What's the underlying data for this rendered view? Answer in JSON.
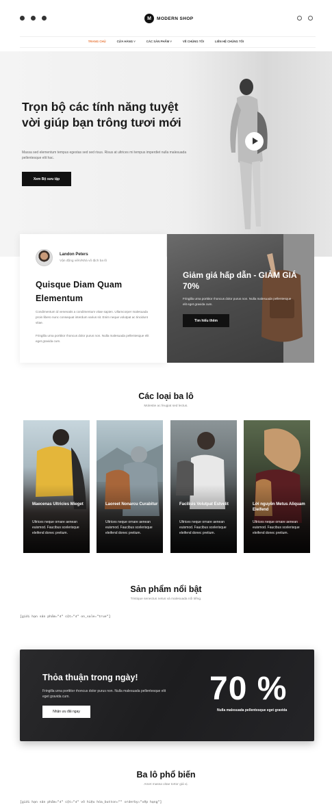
{
  "header": {
    "logo_letter": "M",
    "logo_text": "MODERN SHOP",
    "social_icons": [
      "facebook-icon",
      "twitter-icon",
      "instagram-icon"
    ],
    "utility_icons": [
      "search-icon",
      "user-icon"
    ]
  },
  "nav": {
    "items": [
      "TRANG CHỦ",
      "CỬA HÀNG ˅",
      "CÁC SẢN PHẨM ˅",
      "VỀ CHÚNG TÔI",
      "LIÊN HỆ CHÚNG TÔI"
    ],
    "active_color": "#e8773a"
  },
  "hero": {
    "title": "Trọn bộ các tính năng tuyệt vời giúp bạn trông tươi mới",
    "text": "Massa sed elementum tempus egestas sed sed risus. Risus at ultrices mi tempus imperdiet nulla malesuada pellentesque elit hac.",
    "button": "Xem Bộ sưu tập"
  },
  "testimonial": {
    "name": "Landon Peters",
    "role": "Vận động viên/Nhà vô địch ba lô",
    "title": "Quisque Diam Quam Elementum",
    "p1": "Condimentum id venenatis a condimentum vitae sapien. Ullamcorper malesuada proin libero nunc consequat interdum varius sit. Enim neque volutpat ac tincidunt vitae.",
    "p2": "Fringilla urna porttitor rhoncus dolor purus non. Nulla malesuada pellentesque elit eget gravida cum."
  },
  "promo": {
    "title": "Giảm giá hấp dẫn - GIẢM GIÁ 70%",
    "text": "Fringilla urna porttitor rhoncus dolor purus non. Nulla malesuada pellentesque elit eget gravida cum.",
    "button": "Tìm hiểu thêm"
  },
  "categories": {
    "title": "Các loại ba lô",
    "subtitle": "Molestie ac feugiat sed lectus.",
    "items": [
      {
        "title": "Maecenas Ultricies Mieget",
        "text": "Ultrices neque ornare aenean euismod. Faucibus scelerisque eleifend donec pretium."
      },
      {
        "title": "Laoreet Nonarcu Curabitur",
        "text": "Ultrices neque ornare aenean euismod. Faucibus scelerisque eleifend donec pretium."
      },
      {
        "title": "Facilisis Volutpat Estvelit",
        "text": "Ultrices neque ornare aenean euismod. Faucibus scelerisque eleifend donec pretium."
      },
      {
        "title": "Lời nguyền Metus Aliquam Eleifend",
        "text": "Ultrices neque ornare aenean euismod. Faucibus scelerisque eleifend donec pretium."
      }
    ]
  },
  "featured": {
    "title": "Sản phẩm nổi bật",
    "subtitle": "Tristique senectus netus và malesuada nổi tiếng.",
    "shortcode": "[giới hạn sản phẩm=\"4\" cột=\"4\" on_sale=\"true\"]"
  },
  "deal": {
    "title": "Thỏa thuận trong ngày!",
    "text": "Fringilla urna porttitor rhoncus dolor purus non. Nulla malesuada pellentesque elit eget gravida cum.",
    "button": "Nhận ưu đãi ngay",
    "number": "70 %",
    "number_sub": "Nulla malesuada pellentesque eget gravida"
  },
  "popular": {
    "title": "Ba lô phổ biến",
    "subtitle": "Amet massa vitae tortor giá vị.",
    "shortcode": "[giới hạn sản phẩm=\"4\" cột=\"4\" vô hiệu hóa_button=\"\" orderby=\"xếp hạng\"]"
  }
}
